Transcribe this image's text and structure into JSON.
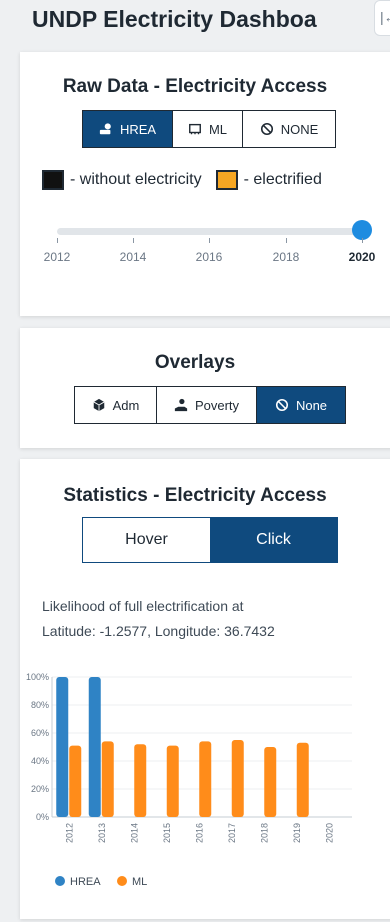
{
  "app": {
    "title": "UNDP Electricity Dashboa",
    "collapse_icon": "collapse-left-icon"
  },
  "raw_data": {
    "title": "Raw Data - Electricity Access",
    "sources": [
      {
        "label": "HREA",
        "icon": "hand-lightbulb-icon",
        "active": true
      },
      {
        "label": "ML",
        "icon": "chip-icon",
        "active": false
      },
      {
        "label": "NONE",
        "icon": "ban-icon",
        "active": false
      }
    ],
    "legend": [
      {
        "label": "- without electricity",
        "color": "#111111"
      },
      {
        "label": "- electrified",
        "color": "#f5a623"
      }
    ],
    "slider": {
      "years": [
        "2012",
        "2014",
        "2016",
        "2018",
        "2020"
      ],
      "selected": "2020",
      "thumb_color": "#1e8ce0"
    }
  },
  "overlays": {
    "title": "Overlays",
    "options": [
      {
        "label": "Adm",
        "icon": "cube-icon",
        "active": false
      },
      {
        "label": "Poverty",
        "icon": "hand-coin-icon",
        "active": false
      },
      {
        "label": "None",
        "icon": "ban-icon",
        "active": true
      }
    ]
  },
  "statistics": {
    "title": "Statistics - Electricity Access",
    "modes": [
      {
        "label": "Hover",
        "active": false
      },
      {
        "label": "Click",
        "active": true
      }
    ],
    "description_line1": "Likelihood of full electrification at",
    "description_line2": "Latitude: -1.2577, Longitude: 36.7432"
  },
  "colors": {
    "accent": "#0f4a7e",
    "hrea": "#2f83c5",
    "ml": "#ff8c1a"
  },
  "chart_data": {
    "type": "bar",
    "categories": [
      "2012",
      "2013",
      "2014",
      "2015",
      "2016",
      "2017",
      "2018",
      "2019",
      "2020"
    ],
    "series": [
      {
        "name": "HREA",
        "values": [
          100,
          100,
          null,
          null,
          null,
          null,
          null,
          null,
          null
        ]
      },
      {
        "name": "ML",
        "values": [
          51,
          54,
          52,
          51,
          54,
          55,
          50,
          53,
          null
        ]
      }
    ],
    "yticks": [
      "0%",
      "20%",
      "40%",
      "60%",
      "80%",
      "100%"
    ],
    "ylim": [
      0,
      100
    ],
    "legend_position": "bottom"
  }
}
